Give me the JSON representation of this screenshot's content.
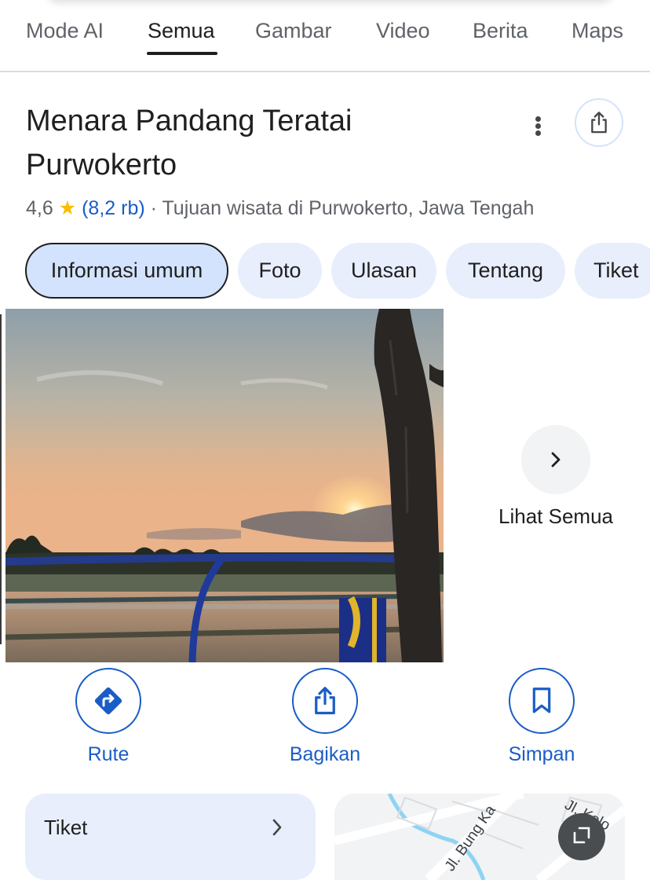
{
  "search_tabs": {
    "items": [
      "Mode AI",
      "Semua",
      "Gambar",
      "Video",
      "Berita",
      "Maps"
    ],
    "active": "Semua"
  },
  "place": {
    "title": "Menara Pandang Teratai Purwokerto",
    "rating": "4,6",
    "star": "★",
    "reviews": "(8,2 rb)",
    "separator": "·",
    "category": "Tujuan wisata di Purwokerto, Jawa Tengah"
  },
  "chips": [
    "Informasi umum",
    "Foto",
    "Ulasan",
    "Tentang",
    "Tiket"
  ],
  "gallery": {
    "see_all_label": "Lihat Semua"
  },
  "actions": {
    "route": "Rute",
    "share": "Bagikan",
    "save": "Simpan"
  },
  "ticket_card": {
    "label": "Tiket"
  },
  "map": {
    "street_1": "Jl. Bung Ka",
    "street_2": "Jl. Kolo"
  },
  "colors": {
    "accent_blue": "#1a5dc6",
    "chip_bg": "#e8eefc",
    "chip_active_bg": "#d3e3fd",
    "star": "#fbbc04"
  },
  "icons": {
    "more": "more-vert-icon",
    "share": "share-icon",
    "chevron": "chevron-right-icon",
    "route": "directions-icon",
    "save": "bookmark-icon",
    "expand": "expand-icon"
  }
}
